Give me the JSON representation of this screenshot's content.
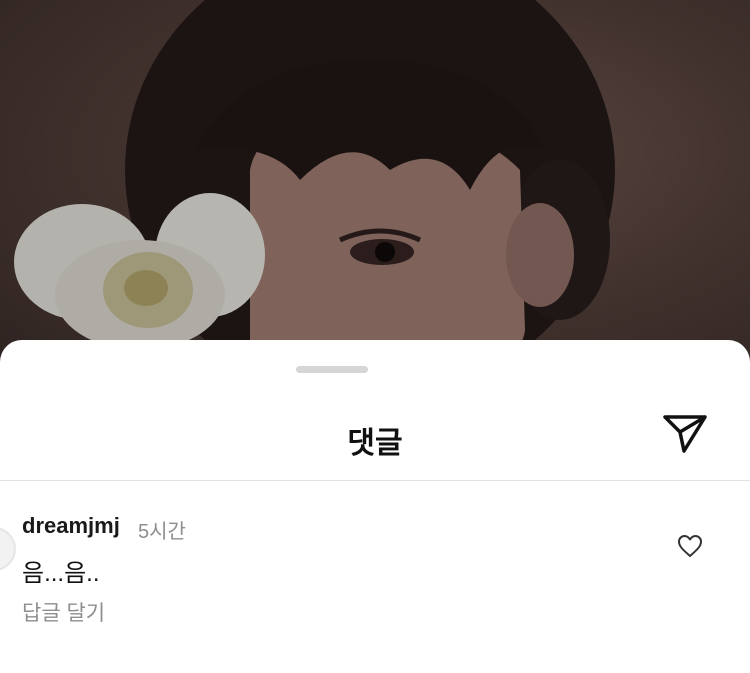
{
  "sheet": {
    "title": "댓글"
  },
  "icons": {
    "send": "paper-plane-icon",
    "like": "heart-icon"
  },
  "comment": {
    "username": "dreamjmj",
    "time": "5시간",
    "text": "음...음..",
    "reply_label": "답글 달기"
  }
}
